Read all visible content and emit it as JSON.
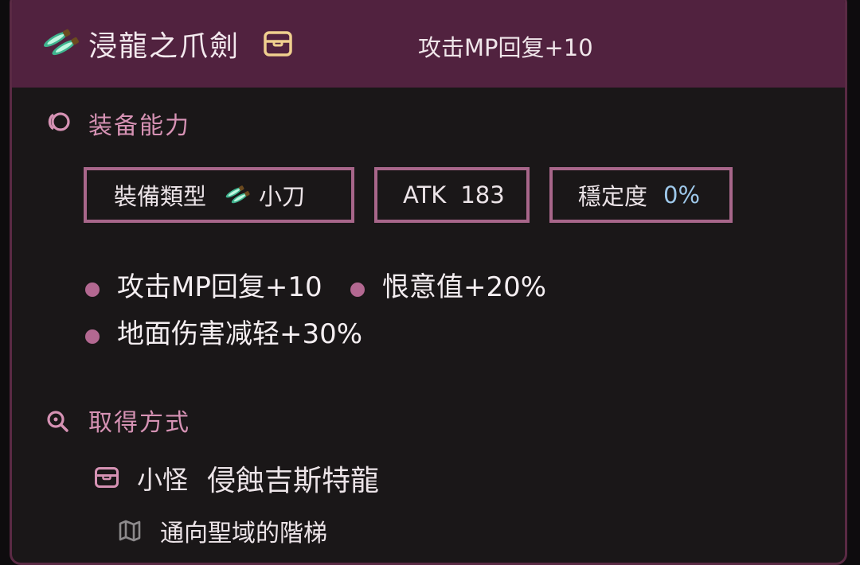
{
  "item": {
    "name": "浸龍之爪劍",
    "summary": "攻击MP回复+10",
    "icon": "dagger-icon",
    "box_icon": "chest-icon"
  },
  "equip_section": {
    "title": "装备能力",
    "icon": "ring-icon",
    "type_label": "裝備類型",
    "type_value": "小刀",
    "atk_label": "ATK",
    "atk_value": "183",
    "stability_label": "穩定度",
    "stability_value": "0%",
    "effects": [
      "攻击MP回复+10",
      "恨意值+20%",
      "地面伤害减轻+30%"
    ]
  },
  "source_section": {
    "title": "取得方式",
    "icon": "search-icon",
    "monster_type": "小怪",
    "monster_name": "侵蝕吉斯特龍",
    "location": "通向聖域的階梯"
  },
  "colors": {
    "header_bg": "#51223f",
    "accent": "#d692b4",
    "box_border": "#a8668a",
    "bullet": "#b36891",
    "value_blue": "#9ec8ea"
  }
}
